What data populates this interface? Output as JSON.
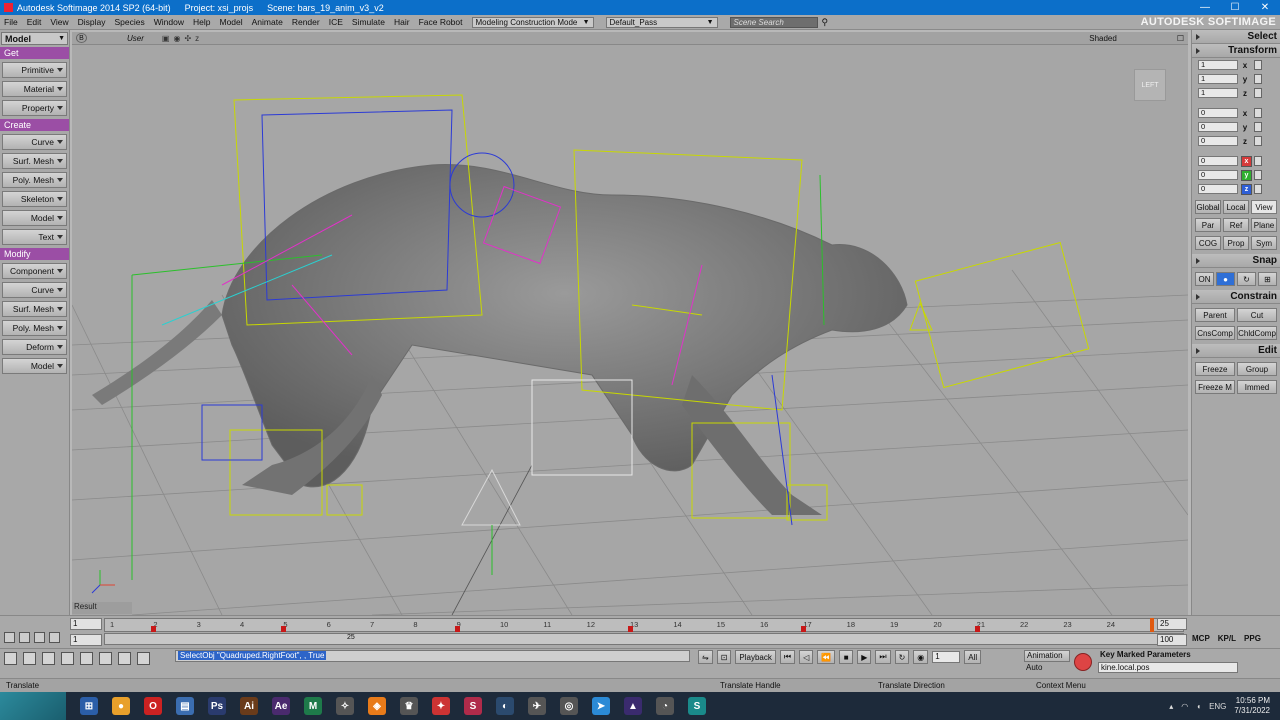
{
  "window": {
    "title_app": "Autodesk Softimage 2014 SP2 (64-bit)",
    "title_project": "Project: xsi_projs",
    "title_scene": "Scene: bars_19_anim_v3_v2",
    "btn_min": "—",
    "btn_max": "☐",
    "btn_close": "✕"
  },
  "menubar": {
    "items": [
      "File",
      "Edit",
      "View",
      "Display",
      "Species",
      "Window",
      "Help",
      "Model",
      "Animate",
      "Render",
      "ICE",
      "Simulate",
      "Hair",
      "Face Robot"
    ],
    "mode": "Modeling Construction Mode",
    "pass": "Default_Pass",
    "search_placeholder": "Scene Search",
    "brand": "AUTODESK SOFTIMAGE"
  },
  "leftpanel": {
    "header": "Model",
    "sections": {
      "get": "Get",
      "create": "Create",
      "modify": "Modify"
    },
    "get_buttons": [
      "Primitive",
      "Material",
      "Property"
    ],
    "create_buttons": [
      "Curve",
      "Surf. Mesh",
      "Poly. Mesh",
      "Skeleton",
      "Model",
      "Text"
    ],
    "modify_buttons": [
      "Component",
      "Curve",
      "Surf. Mesh",
      "Poly. Mesh",
      "Deform",
      "Model"
    ]
  },
  "viewport": {
    "camera": "User",
    "shading": "Shaded",
    "cube_label": "LEFT",
    "result_label": "Result"
  },
  "rightpanel": {
    "select": "Select",
    "transform": "Transform",
    "scale": [
      {
        "v": "1",
        "axis": "x"
      },
      {
        "v": "1",
        "axis": "y"
      },
      {
        "v": "1",
        "axis": "z"
      }
    ],
    "rotate": [
      {
        "v": "0",
        "axis": "x"
      },
      {
        "v": "0",
        "axis": "y"
      },
      {
        "v": "0",
        "axis": "z"
      }
    ],
    "translate": [
      {
        "v": "0",
        "axis": "x"
      },
      {
        "v": "0",
        "axis": "y"
      },
      {
        "v": "0",
        "axis": "z"
      }
    ],
    "space_buttons": [
      "Global",
      "Local",
      "View"
    ],
    "ref_buttons": [
      "Par",
      "Ref",
      "Plane"
    ],
    "cog_buttons": [
      "COG",
      "Prop",
      "Sym"
    ],
    "snap": "Snap",
    "snap_on": "ON",
    "constrain": "Constrain",
    "constrain_row1": [
      "Parent",
      "Cut"
    ],
    "constrain_row2": [
      "CnsComp",
      "ChldComp"
    ],
    "edit": "Edit",
    "edit_row1": [
      "Freeze",
      "Group"
    ],
    "edit_row2": [
      "Freeze M",
      "Immed"
    ]
  },
  "timeline": {
    "start": "1",
    "start2": "1",
    "end": "25",
    "end2": "100",
    "ticks": [
      "1",
      "2",
      "3",
      "4",
      "5",
      "6",
      "7",
      "8",
      "9",
      "10",
      "11",
      "12",
      "13",
      "14",
      "15",
      "16",
      "17",
      "18",
      "19",
      "20",
      "21",
      "22",
      "23",
      "24"
    ],
    "key_frames": [
      2,
      5,
      9,
      13,
      17,
      21
    ],
    "current_frame": 25,
    "sub_label": "25",
    "tabs": [
      "MCP",
      "KP/L",
      "PPG"
    ]
  },
  "cmdbar": {
    "command": "SelectObj \"Quadruped.RightFoot\", , True",
    "playback": "Playback",
    "frame": "1",
    "all": "All",
    "animation": "Animation",
    "auto": "Auto",
    "key_marked": "Key Marked Parameters",
    "kine_field": "kine.local.pos"
  },
  "statusbar": {
    "left": "Translate",
    "handle": "Translate Handle",
    "direction": "Translate Direction",
    "context": "Context Menu"
  },
  "taskbar": {
    "lang": "ENG",
    "time": "10:56 PM",
    "date": "7/31/2022"
  }
}
